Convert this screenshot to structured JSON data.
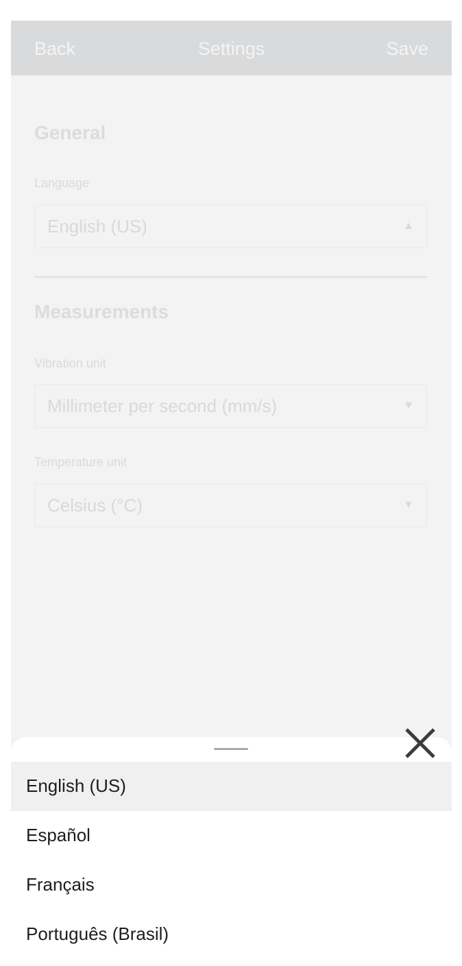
{
  "header": {
    "back_label": "Back",
    "title": "Settings",
    "save_label": "Save"
  },
  "general": {
    "section_title": "General",
    "language_label": "Language",
    "language_value": "English (US)",
    "language_caret": "▲"
  },
  "measurements": {
    "section_title": "Measurements",
    "vibration_label": "Vibration unit",
    "vibration_value": "Millimeter per second (mm/s)",
    "vibration_caret": "▼",
    "temperature_label": "Temperature unit",
    "temperature_value": "Celsius (°C)",
    "temperature_caret": "▼"
  },
  "language_sheet": {
    "close_icon": "close-icon",
    "selected": "English (US)",
    "options": [
      {
        "label": "English (US)"
      },
      {
        "label": "Español"
      },
      {
        "label": "Français"
      },
      {
        "label": "Português (Brasil)"
      }
    ]
  },
  "colors": {
    "header_background": "#d9dadb",
    "page_background": "#f3f3f3",
    "sheet_background": "#ffffff",
    "selected_option_background": "#f0f0f0"
  }
}
